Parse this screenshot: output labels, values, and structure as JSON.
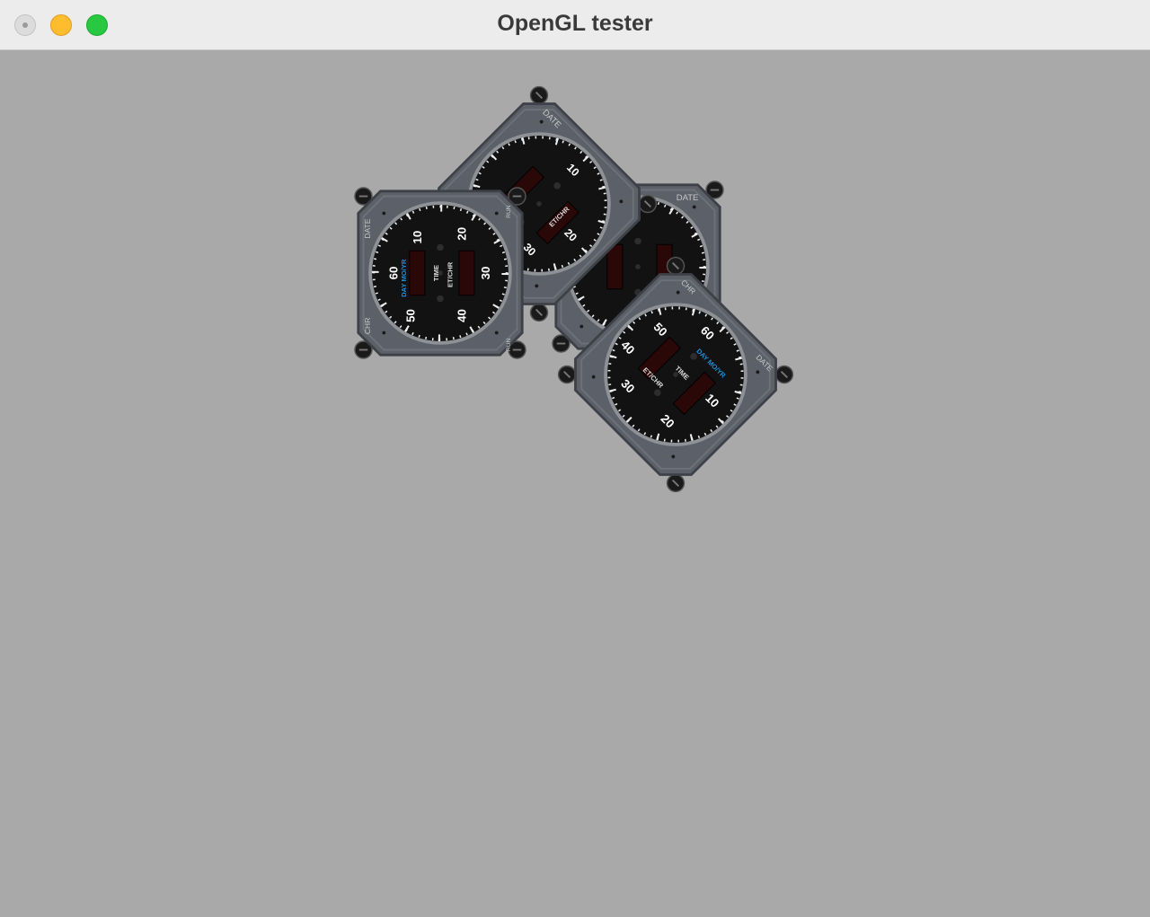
{
  "window": {
    "title": "OpenGL tester"
  },
  "gauge": {
    "dial_numbers": [
      "10",
      "20",
      "30",
      "40",
      "50",
      "60"
    ],
    "window_left_label": "DAY MO/YR",
    "center_label": "TIME",
    "window_right_label": "ET/CHR",
    "corner_top_left": "DATE",
    "corner_bottom_left": "CHR",
    "corner_top_right": "RUN",
    "corner_bottom_right": "RUN"
  },
  "colors": {
    "background": "#a9a9a9",
    "bezel": "#5c6068",
    "dial_face": "#121212",
    "accent_blue": "#1f8fd8"
  }
}
